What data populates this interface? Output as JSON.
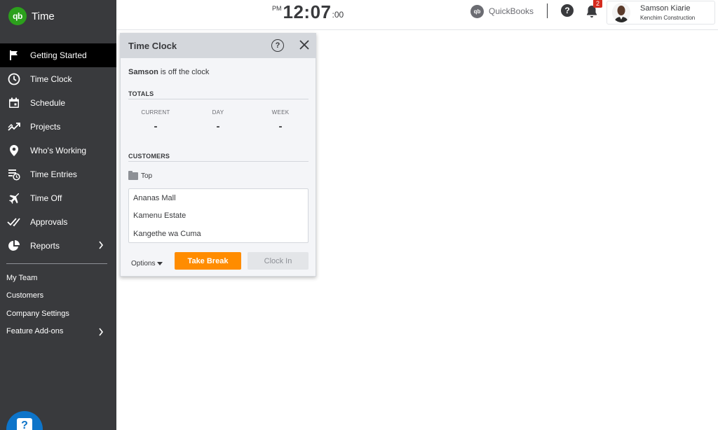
{
  "app": {
    "logo": "qb",
    "name": "Time"
  },
  "nav": {
    "items": [
      {
        "label": "Getting Started",
        "icon": "flag-icon",
        "active": true
      },
      {
        "label": "Time Clock",
        "icon": "clock-icon"
      },
      {
        "label": "Schedule",
        "icon": "calendar-icon"
      },
      {
        "label": "Projects",
        "icon": "trend-icon"
      },
      {
        "label": "Who's Working",
        "icon": "location-pin-icon"
      },
      {
        "label": "Time Entries",
        "icon": "time-entries-icon"
      },
      {
        "label": "Time Off",
        "icon": "airplane-icon"
      },
      {
        "label": "Approvals",
        "icon": "double-check-icon"
      },
      {
        "label": "Reports",
        "icon": "pie-chart-icon",
        "has_submenu": true
      }
    ],
    "secondary": [
      {
        "label": "My Team"
      },
      {
        "label": "Customers"
      },
      {
        "label": "Company Settings"
      },
      {
        "label": "Feature Add-ons",
        "has_submenu": true
      }
    ]
  },
  "topbar": {
    "clock": {
      "ampm": "PM",
      "time": "12:07",
      "seconds": ":00"
    },
    "quickbooks": {
      "logo": "qb",
      "label": "QuickBooks"
    },
    "help": "?",
    "notifications": {
      "count": "2"
    },
    "user": {
      "name": "Samson Kiarie",
      "company": "Kenchim Construction"
    }
  },
  "panel": {
    "title": "Time Clock",
    "help": "?",
    "status": {
      "name": "Samson",
      "text": " is off the clock"
    },
    "totals_label": "TOTALS",
    "totals": [
      {
        "label": "CURRENT",
        "value": "-"
      },
      {
        "label": "DAY",
        "value": "-"
      },
      {
        "label": "WEEK",
        "value": "-"
      }
    ],
    "customers_label": "CUSTOMERS",
    "folder": "Top",
    "customers": [
      "Ananas Mall",
      "Kamenu Estate",
      "Kangethe wa Cuma"
    ],
    "options_label": "Options",
    "take_break_label": "Take Break",
    "clock_in_label": "Clock In"
  },
  "help_bubble": "?",
  "colors": {
    "sidebar": "#393a3d",
    "active_nav": "#000000",
    "brand_green": "#2ca01c",
    "take_break": "#ff8c00",
    "badge": "#d52b1e",
    "help_bubble": "#0d74c9"
  }
}
